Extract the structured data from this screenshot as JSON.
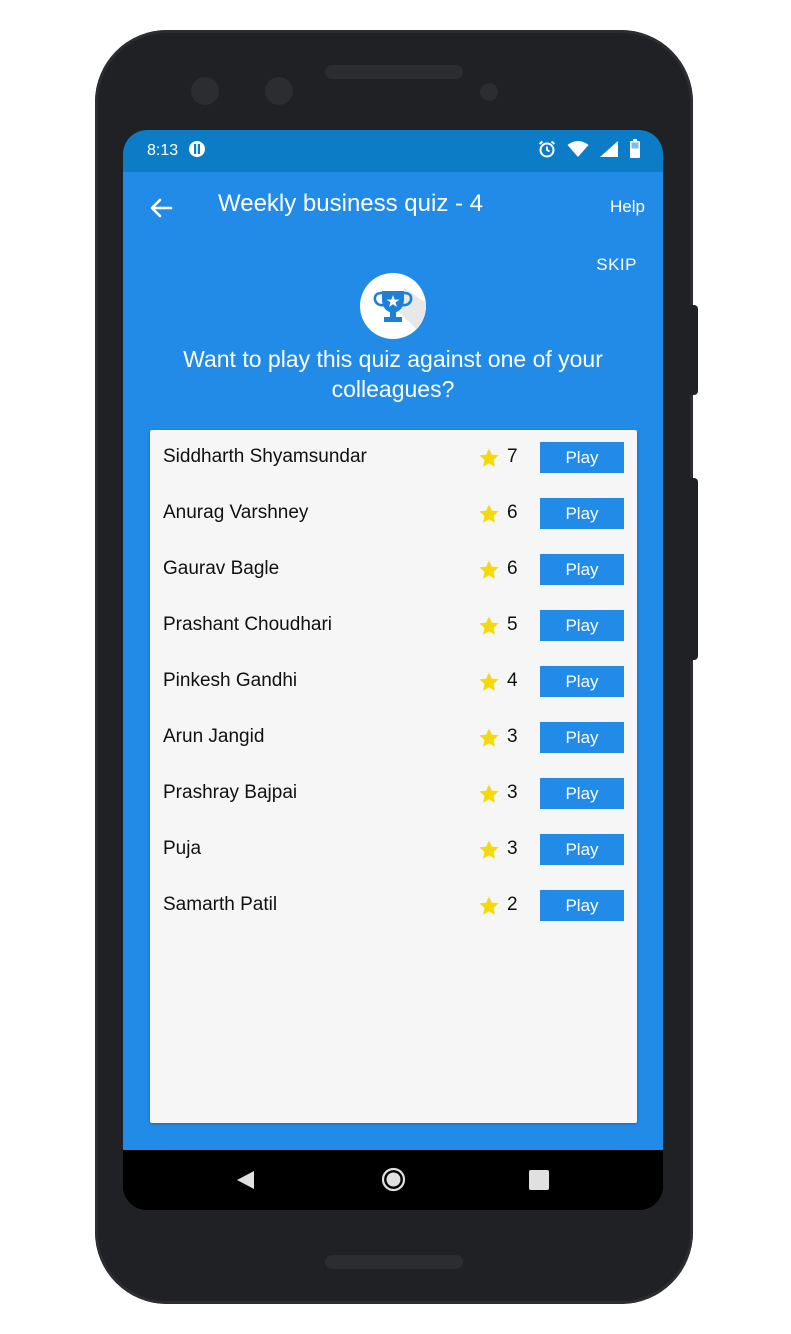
{
  "status": {
    "time": "8:13"
  },
  "toolbar": {
    "title": "Weekly business quiz - 4",
    "help_label": "Help"
  },
  "skip_label": "SKIP",
  "prompt": "Want to play this quiz against one of your colleagues?",
  "players": [
    {
      "name": "Siddharth Shyamsundar",
      "score": "7",
      "play_label": "Play"
    },
    {
      "name": "Anurag Varshney",
      "score": "6",
      "play_label": "Play"
    },
    {
      "name": "Gaurav Bagle",
      "score": "6",
      "play_label": "Play"
    },
    {
      "name": "Prashant Choudhari",
      "score": "5",
      "play_label": "Play"
    },
    {
      "name": "Pinkesh Gandhi",
      "score": "4",
      "play_label": "Play"
    },
    {
      "name": "Arun Jangid",
      "score": "3",
      "play_label": "Play"
    },
    {
      "name": "Prashray Bajpai",
      "score": "3",
      "play_label": "Play"
    },
    {
      "name": "Puja",
      "score": "3",
      "play_label": "Play"
    },
    {
      "name": "Samarth Patil",
      "score": "2",
      "play_label": "Play"
    }
  ],
  "icons": {
    "back": "arrow-left-icon",
    "trophy": "trophy-icon",
    "star": "star-icon",
    "alarm": "alarm-icon",
    "wifi": "wifi-icon",
    "signal": "signal-icon",
    "battery": "battery-icon",
    "nav_back": "nav-back-icon",
    "nav_home": "nav-home-icon",
    "nav_recents": "nav-recents-icon"
  },
  "colors": {
    "status_bar": "#0d7cc6",
    "primary": "#228be8",
    "card": "#f6f6f6",
    "star": "#f5d90a",
    "trophy": "#1e7fd6"
  }
}
